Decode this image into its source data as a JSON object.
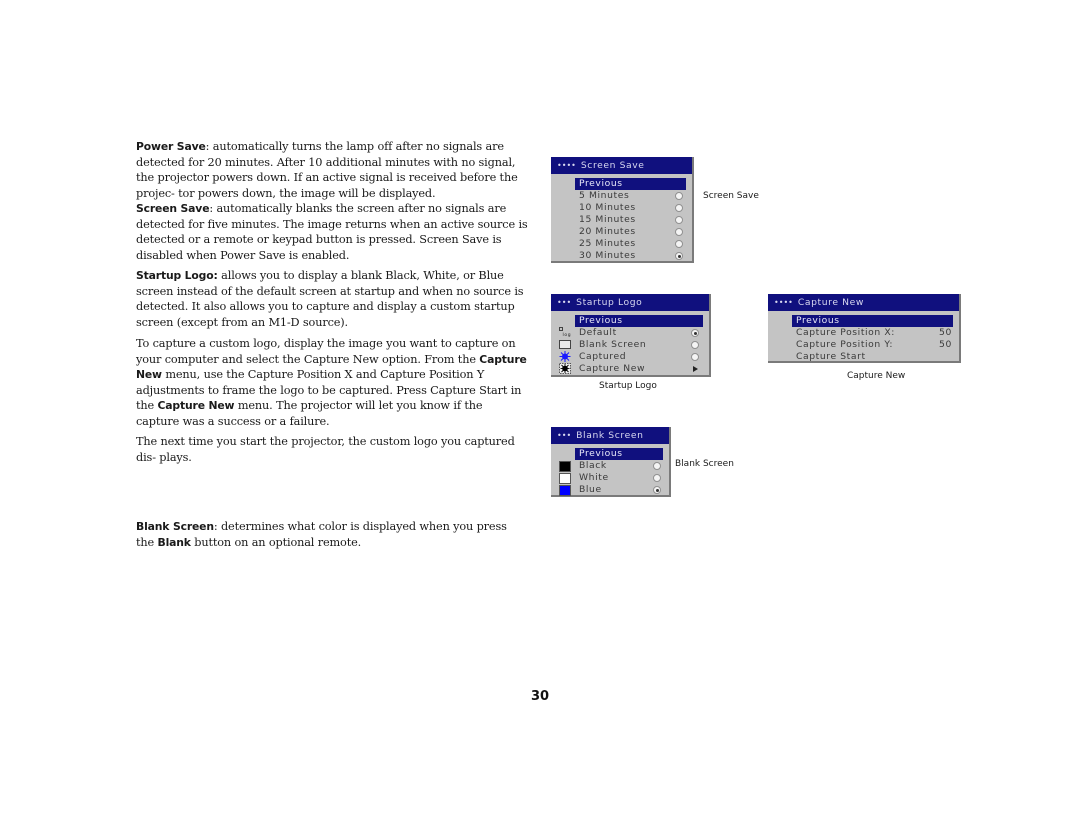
{
  "paragraphs": {
    "power_save": {
      "term": "Power Save",
      "text": ": automatically turns the lamp off after no signals are detected for 20 minutes. After 10 additional minutes with no signal, the projector powers down. If an active signal is received before the projec- tor powers down, the image will be displayed."
    },
    "screen_save": {
      "term": "Screen Save",
      "text": ": automatically blanks the screen after no signals are detected for five minutes. The image returns when an active source is detected or a remote or keypad button is pressed. Screen Save is disabled when Power Save is enabled."
    },
    "startup_logo": {
      "term": "Startup Logo:",
      "text": " allows you to display a blank Black, White, or Blue screen instead of the default screen at startup and when no source is detected. It also allows you to capture and display a custom startup screen (except from an M1-D source)."
    },
    "capture": {
      "part1": "To capture a custom logo, display the image you want to capture on your computer and select the Capture New option. From the ",
      "bold1": "Capture New",
      "part2": " menu, use the Capture Position X and Capture Position Y adjustments to frame the logo to be captured. Press Capture Start in the ",
      "bold2": "Capture New",
      "part3": " menu. The projector will let you know if the capture was a success or a failure."
    },
    "next_time": {
      "text": "The next time you start the projector, the custom logo you captured dis- plays."
    },
    "blank_screen": {
      "term": "Blank Screen",
      "text": ": determines what color is displayed when you press the ",
      "bold2": "Blank",
      "text2": " button on an optional remote."
    }
  },
  "menus": {
    "screen_save": {
      "dots": "••••",
      "title": "Screen Save",
      "previous": "Previous",
      "items": [
        {
          "label": "5 Minutes",
          "selected": false
        },
        {
          "label": "10 Minutes",
          "selected": false
        },
        {
          "label": "15 Minutes",
          "selected": false
        },
        {
          "label": "20 Minutes",
          "selected": false
        },
        {
          "label": "25 Minutes",
          "selected": false
        },
        {
          "label": "30 Minutes",
          "selected": true
        }
      ],
      "caption": "Screen Save"
    },
    "startup_logo": {
      "dots": "•••",
      "title": "Startup Logo",
      "previous": "Previous",
      "items": [
        {
          "label": "Default",
          "icon": "logo-icon",
          "control": "radio",
          "selected": true
        },
        {
          "label": "Blank Screen",
          "icon": "blank-screen-icon",
          "control": "radio",
          "selected": false
        },
        {
          "label": "Captured",
          "icon": "captured-icon",
          "control": "radio",
          "selected": false
        },
        {
          "label": "Capture New",
          "icon": "capture-new-icon",
          "control": "submenu-arrow"
        }
      ],
      "caption": "Startup Logo"
    },
    "capture_new": {
      "dots": "••••",
      "title": "Capture New",
      "previous": "Previous",
      "items": [
        {
          "label": "Capture Position X:",
          "value": "50"
        },
        {
          "label": "Capture Position Y:",
          "value": "50"
        },
        {
          "label": "Capture Start",
          "value": ""
        }
      ],
      "caption": "Capture New"
    },
    "blank_screen": {
      "dots": "•••",
      "title": "Blank Screen",
      "previous": "Previous",
      "items": [
        {
          "label": "Black",
          "swatch": "#000000",
          "selected": false
        },
        {
          "label": "White",
          "swatch": "#ffffff",
          "selected": false
        },
        {
          "label": "Blue",
          "swatch": "#0000ff",
          "selected": true
        }
      ],
      "caption": "Blank Screen"
    }
  },
  "page_number": "30"
}
